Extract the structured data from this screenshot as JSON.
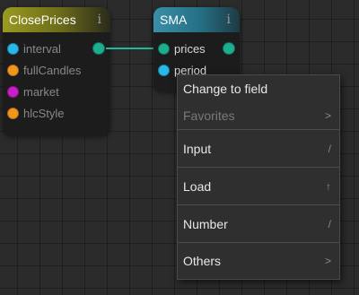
{
  "nodes": {
    "close_prices": {
      "title": "ClosePrices",
      "info": "i",
      "header_color": "#8a8a1e",
      "inputs": [
        {
          "label": "interval",
          "color": "#29b6e8"
        },
        {
          "label": "fullCandles",
          "color": "#f0961e"
        },
        {
          "label": "market",
          "color": "#c81ec8"
        },
        {
          "label": "hlcStyle",
          "color": "#f0961e"
        }
      ],
      "output_color": "#1fad8f"
    },
    "sma": {
      "title": "SMA",
      "info": "i",
      "header_color": "#2b7f96",
      "inputs": [
        {
          "label": "prices",
          "color": "#1fad8f"
        },
        {
          "label": "period",
          "color": "#29b6e8"
        }
      ],
      "output_color": "#1fad8f"
    }
  },
  "context_menu": {
    "items": [
      {
        "label": "Change to field",
        "arrow": "",
        "disabled": false
      },
      {
        "label": "Favorites",
        "arrow": ">",
        "disabled": true
      },
      {
        "label": "Input",
        "arrow": "/",
        "disabled": false
      },
      {
        "label": "Load",
        "arrow": "↑",
        "disabled": false
      },
      {
        "label": "Number",
        "arrow": "/",
        "disabled": false
      },
      {
        "label": "Others",
        "arrow": ">",
        "disabled": false
      }
    ]
  }
}
